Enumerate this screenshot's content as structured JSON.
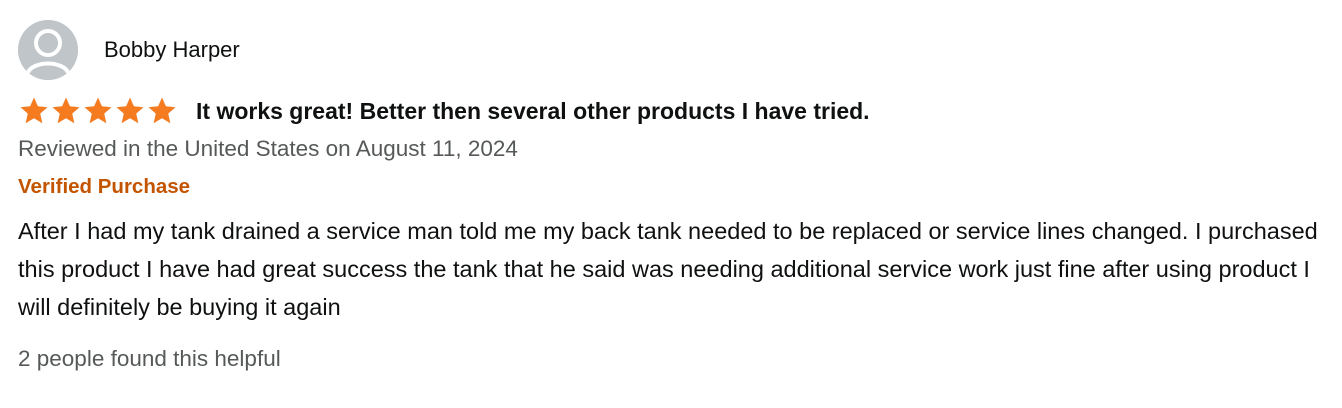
{
  "reviewer": {
    "name": "Bobby Harper",
    "avatar_icon": "user-avatar-icon"
  },
  "review": {
    "rating": 5,
    "rating_max": 5,
    "star_color": "#f47b20",
    "title": "It works great! Better then several other products I have tried.",
    "date_text": "Reviewed in the United States on August 11, 2024",
    "verified_label": "Verified Purchase",
    "verified_color": "#c45500",
    "body": "After I had my tank drained a service man told me my back tank needed to be replaced or service lines changed. I purchased this product I have had great success the tank that he said was needing additional service work just fine after using product I will definitely be buying it again",
    "helpful_text": "2 people found this helpful"
  }
}
